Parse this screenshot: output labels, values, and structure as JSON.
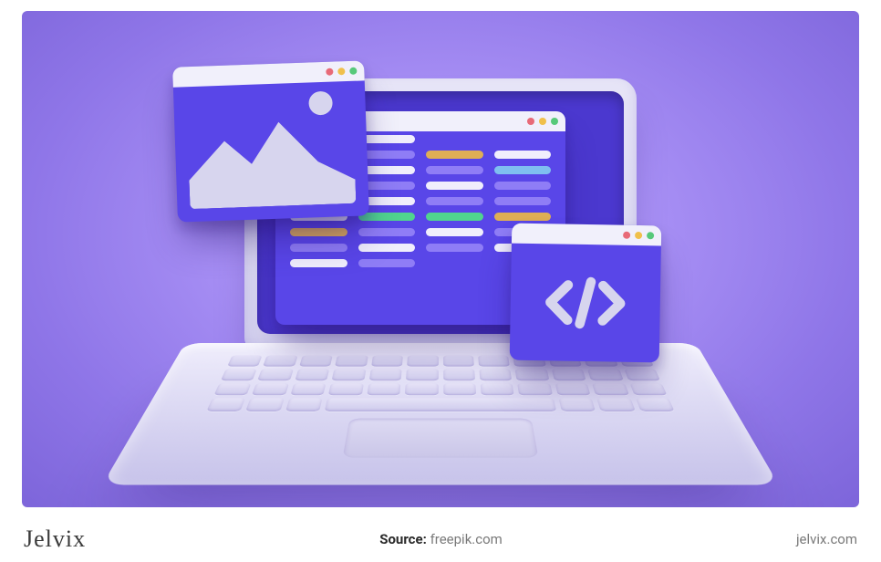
{
  "footer": {
    "brand": "Jelvix",
    "source_label": "Source:",
    "source_value": "freepik.com",
    "site": "jelvix.com"
  },
  "windows": {
    "image_window": {
      "name": "image-window"
    },
    "code_window": {
      "name": "code-window"
    },
    "tag_window": {
      "name": "code-tag-window",
      "glyph": "</>"
    }
  },
  "code_lines": [
    {
      "row": [
        "#f0eefc",
        "#f0eefc",
        "",
        ""
      ]
    },
    {
      "row": [
        "#8f7df6",
        "#8f7df6",
        "#dfae55",
        "#f0eefc"
      ]
    },
    {
      "row": [
        "#50d58e",
        "#f0eefc",
        "#8f7df6",
        "#7fbff0"
      ]
    },
    {
      "row": [
        "#f0eefc",
        "#8f7df6",
        "#f0eefc",
        "#8f7df6"
      ]
    },
    {
      "row": [
        "#8f7df6",
        "#f0eefc",
        "#8f7df6",
        "#8f7df6"
      ]
    },
    {
      "row": [
        "#f0eefc",
        "#50d58e",
        "#50d58e",
        "#dfae55"
      ]
    },
    {
      "row": [
        "#dfae55",
        "#8f7df6",
        "#f0eefc",
        "#8f7df6"
      ]
    },
    {
      "row": [
        "#8f7df6",
        "#f0eefc",
        "#8f7df6",
        "#f0eefc"
      ]
    },
    {
      "row": [
        "#f0eefc",
        "#8f7df6",
        "",
        ""
      ]
    }
  ],
  "colors": {
    "window_bg": "#5946e8",
    "panel_bg": "#d7d5ee",
    "stage_bg": "#a890f5"
  }
}
